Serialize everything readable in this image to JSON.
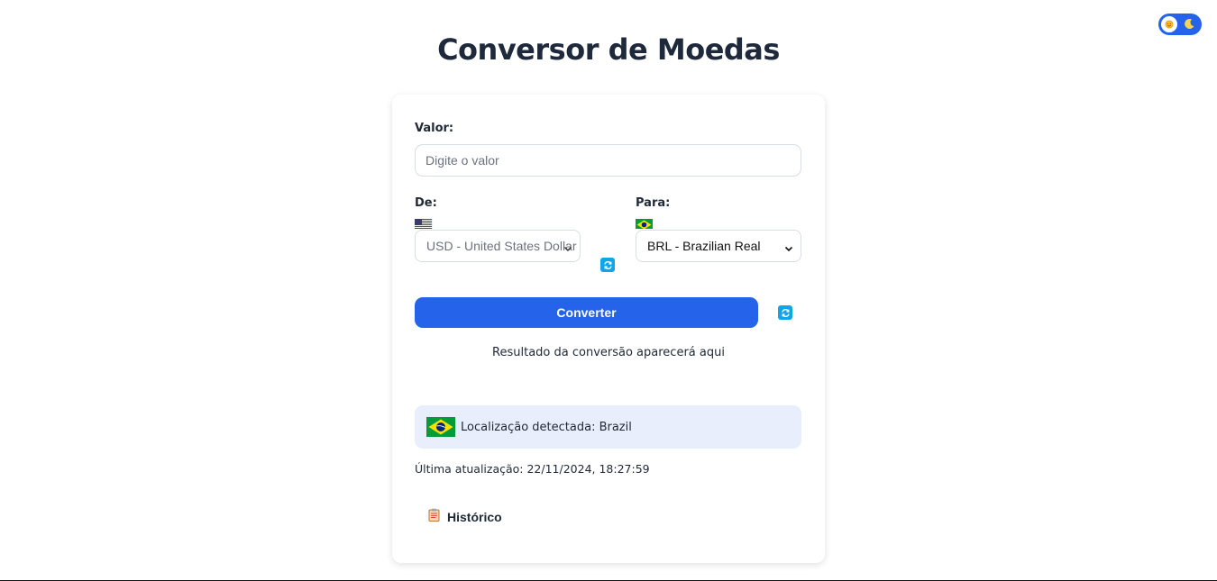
{
  "header": {
    "title": "Conversor de Moedas"
  },
  "theme_toggle": {
    "sun_icon": "sun-icon",
    "moon_icon": "moon-icon",
    "accent": "#2563eb"
  },
  "form": {
    "amount_label": "Valor:",
    "amount_placeholder": "Digite o valor",
    "amount_value": "",
    "from_label": "De:",
    "from_flag": "us-flag",
    "from_selected": "USD - United States Dollar",
    "to_label": "Para:",
    "to_flag": "br-flag",
    "to_selected": "BRL - Brazilian Real",
    "swap_icon": "swap-icon",
    "convert_label": "Converter",
    "convert_color": "#2563eb"
  },
  "result": {
    "text": "Resultado da conversão aparecerá aqui"
  },
  "location": {
    "flag": "br-flag",
    "text": "Localização detectada: Brazil",
    "background": "#e8eefb"
  },
  "last_update": {
    "text": "Última atualização: 22/11/2024, 18:27:59"
  },
  "history": {
    "icon": "clipboard-icon",
    "label": "Histórico"
  }
}
